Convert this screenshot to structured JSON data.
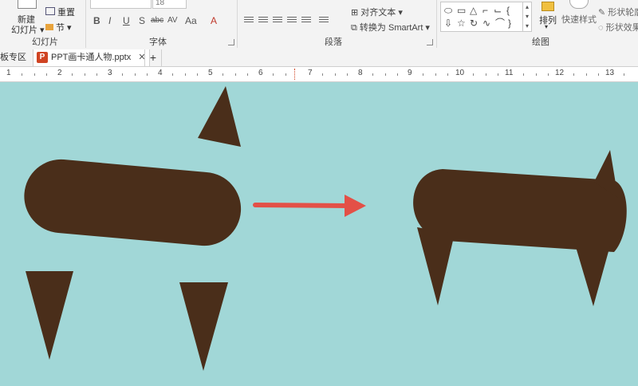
{
  "ribbon": {
    "new_slide_line1": "新建",
    "new_slide_line2": "幻灯片",
    "reset_label": "重置",
    "section_label": "节",
    "slides_group_label": "幻灯片",
    "font_size": "18",
    "font_group_label": "字体",
    "text_direction_label": "对齐文本",
    "convert_smartart_label": "转换为 SmartArt",
    "paragraph_group_label": "段落",
    "arrange_label": "排列",
    "quick_styles_label": "快速样式",
    "shape_outline_label": "形状轮廓",
    "shape_effects_label": "形状效果",
    "drawing_group_label": "绘图",
    "format_bold": "B",
    "format_italic": "I",
    "format_underline": "U",
    "format_shadow": "S",
    "format_strike": "abc",
    "format_spacing": "AV",
    "format_case": "Aa",
    "format_color": "A"
  },
  "tabs": [
    {
      "label": "板专区"
    },
    {
      "label": "PPT画卡通人物.pptx"
    }
  ],
  "ruler": {
    "numbers": [
      "1",
      "2",
      "3",
      "4",
      "5",
      "6",
      "7",
      "8",
      "9",
      "10",
      "11",
      "12",
      "13"
    ]
  },
  "colors": {
    "slide_background": "#a1d7d7",
    "shape_fill": "#4a2e1a",
    "arrow": "#e35047"
  }
}
